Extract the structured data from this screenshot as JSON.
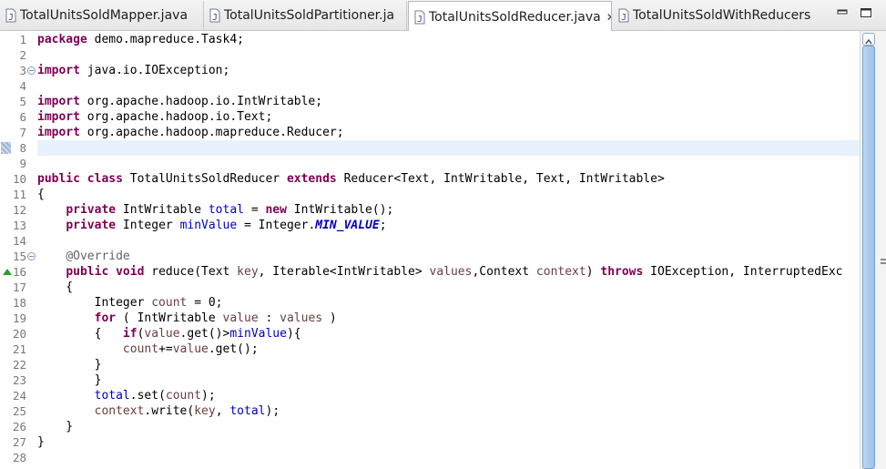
{
  "tabs": [
    {
      "label": "TotalUnitsSoldMapper.java",
      "active": false
    },
    {
      "label": "TotalUnitsSoldPartitioner.ja",
      "active": false
    },
    {
      "label": "TotalUnitsSoldReducer.java",
      "active": true
    },
    {
      "label": "TotalUnitsSoldWithReducers",
      "active": false
    }
  ],
  "close_glyph": "✕",
  "icons": {
    "tab_file": "java-file-icon",
    "close": "close-icon",
    "minimize": "minimize-icon",
    "maximize": "maximize-icon",
    "fold": "collapse-icon",
    "bookmark": "bookmark-icon",
    "override": "override-marker-icon"
  },
  "colors": {
    "keyword": "#7f0055",
    "field": "#0000c0",
    "local_var": "#6a3e3e",
    "annotation": "#646464",
    "current_line": "#e8f2fe",
    "gutter_text": "#787878"
  },
  "editor": {
    "current_line": 8,
    "lines": [
      {
        "n": "1",
        "tokens": [
          {
            "t": "package",
            "c": "kw"
          },
          {
            "t": " demo.mapreduce.Task4;"
          }
        ]
      },
      {
        "n": "2",
        "tokens": []
      },
      {
        "n": "3",
        "tokens": [
          {
            "t": "import",
            "c": "kw"
          },
          {
            "t": " java.io.IOException;"
          }
        ]
      },
      {
        "n": "4",
        "tokens": []
      },
      {
        "n": "5",
        "tokens": [
          {
            "t": "import",
            "c": "kw"
          },
          {
            "t": " org.apache.hadoop.io.IntWritable;"
          }
        ]
      },
      {
        "n": "6",
        "tokens": [
          {
            "t": "import",
            "c": "kw"
          },
          {
            "t": " org.apache.hadoop.io.Text;"
          }
        ]
      },
      {
        "n": "7",
        "tokens": [
          {
            "t": "import",
            "c": "kw"
          },
          {
            "t": " org.apache.hadoop.mapreduce.Reducer;"
          }
        ]
      },
      {
        "n": "8",
        "tokens": []
      },
      {
        "n": "9",
        "tokens": []
      },
      {
        "n": "10",
        "tokens": [
          {
            "t": "public",
            "c": "kw"
          },
          {
            "t": " "
          },
          {
            "t": "class",
            "c": "kw"
          },
          {
            "t": " TotalUnitsSoldReducer "
          },
          {
            "t": "extends",
            "c": "kw"
          },
          {
            "t": " Reducer<Text, IntWritable, Text, IntWritable>"
          }
        ]
      },
      {
        "n": "11",
        "tokens": [
          {
            "t": "{"
          }
        ]
      },
      {
        "n": "12",
        "tokens": [
          {
            "t": "    "
          },
          {
            "t": "private",
            "c": "kw"
          },
          {
            "t": " IntWritable "
          },
          {
            "t": "total",
            "c": "fld"
          },
          {
            "t": " = "
          },
          {
            "t": "new",
            "c": "kw"
          },
          {
            "t": " IntWritable();"
          }
        ]
      },
      {
        "n": "13",
        "tokens": [
          {
            "t": "    "
          },
          {
            "t": "private",
            "c": "kw"
          },
          {
            "t": " Integer "
          },
          {
            "t": "minValue",
            "c": "fld"
          },
          {
            "t": " = Integer."
          },
          {
            "t": "MIN_VALUE",
            "c": "sfld"
          },
          {
            "t": ";"
          }
        ]
      },
      {
        "n": "14",
        "tokens": []
      },
      {
        "n": "15",
        "tokens": [
          {
            "t": "    "
          },
          {
            "t": "@Override",
            "c": "ann"
          }
        ]
      },
      {
        "n": "16",
        "tokens": [
          {
            "t": "    "
          },
          {
            "t": "public",
            "c": "kw"
          },
          {
            "t": " "
          },
          {
            "t": "void",
            "c": "kw"
          },
          {
            "t": " reduce(Text "
          },
          {
            "t": "key",
            "c": "var"
          },
          {
            "t": ", Iterable<IntWritable> "
          },
          {
            "t": "values",
            "c": "var"
          },
          {
            "t": ",Context "
          },
          {
            "t": "context",
            "c": "var"
          },
          {
            "t": ") "
          },
          {
            "t": "throws",
            "c": "kw"
          },
          {
            "t": " IOException, InterruptedExc"
          }
        ]
      },
      {
        "n": "17",
        "tokens": [
          {
            "t": "    {"
          }
        ]
      },
      {
        "n": "18",
        "tokens": [
          {
            "t": "        Integer "
          },
          {
            "t": "count",
            "c": "var"
          },
          {
            "t": " = 0;"
          }
        ]
      },
      {
        "n": "19",
        "tokens": [
          {
            "t": "        "
          },
          {
            "t": "for",
            "c": "kw"
          },
          {
            "t": " ( IntWritable "
          },
          {
            "t": "value",
            "c": "var"
          },
          {
            "t": " : "
          },
          {
            "t": "values",
            "c": "var"
          },
          {
            "t": " )"
          }
        ]
      },
      {
        "n": "20",
        "tokens": [
          {
            "t": "        {   "
          },
          {
            "t": "if",
            "c": "kw"
          },
          {
            "t": "("
          },
          {
            "t": "value",
            "c": "var"
          },
          {
            "t": ".get()>"
          },
          {
            "t": "minValue",
            "c": "fld"
          },
          {
            "t": "){"
          }
        ]
      },
      {
        "n": "21",
        "tokens": [
          {
            "t": "            "
          },
          {
            "t": "count",
            "c": "var"
          },
          {
            "t": "+="
          },
          {
            "t": "value",
            "c": "var"
          },
          {
            "t": ".get();"
          }
        ]
      },
      {
        "n": "22",
        "tokens": [
          {
            "t": "        }"
          }
        ]
      },
      {
        "n": "23",
        "tokens": [
          {
            "t": "        }"
          }
        ]
      },
      {
        "n": "24",
        "tokens": [
          {
            "t": "        "
          },
          {
            "t": "total",
            "c": "fld"
          },
          {
            "t": ".set("
          },
          {
            "t": "count",
            "c": "var"
          },
          {
            "t": ");"
          }
        ]
      },
      {
        "n": "25",
        "tokens": [
          {
            "t": "        "
          },
          {
            "t": "context",
            "c": "var"
          },
          {
            "t": ".write("
          },
          {
            "t": "key",
            "c": "var"
          },
          {
            "t": ", "
          },
          {
            "t": "total",
            "c": "fld"
          },
          {
            "t": ");"
          }
        ]
      },
      {
        "n": "26",
        "tokens": [
          {
            "t": "    }"
          }
        ]
      },
      {
        "n": "27",
        "tokens": [
          {
            "t": "}"
          }
        ]
      },
      {
        "n": "28",
        "tokens": []
      }
    ]
  }
}
